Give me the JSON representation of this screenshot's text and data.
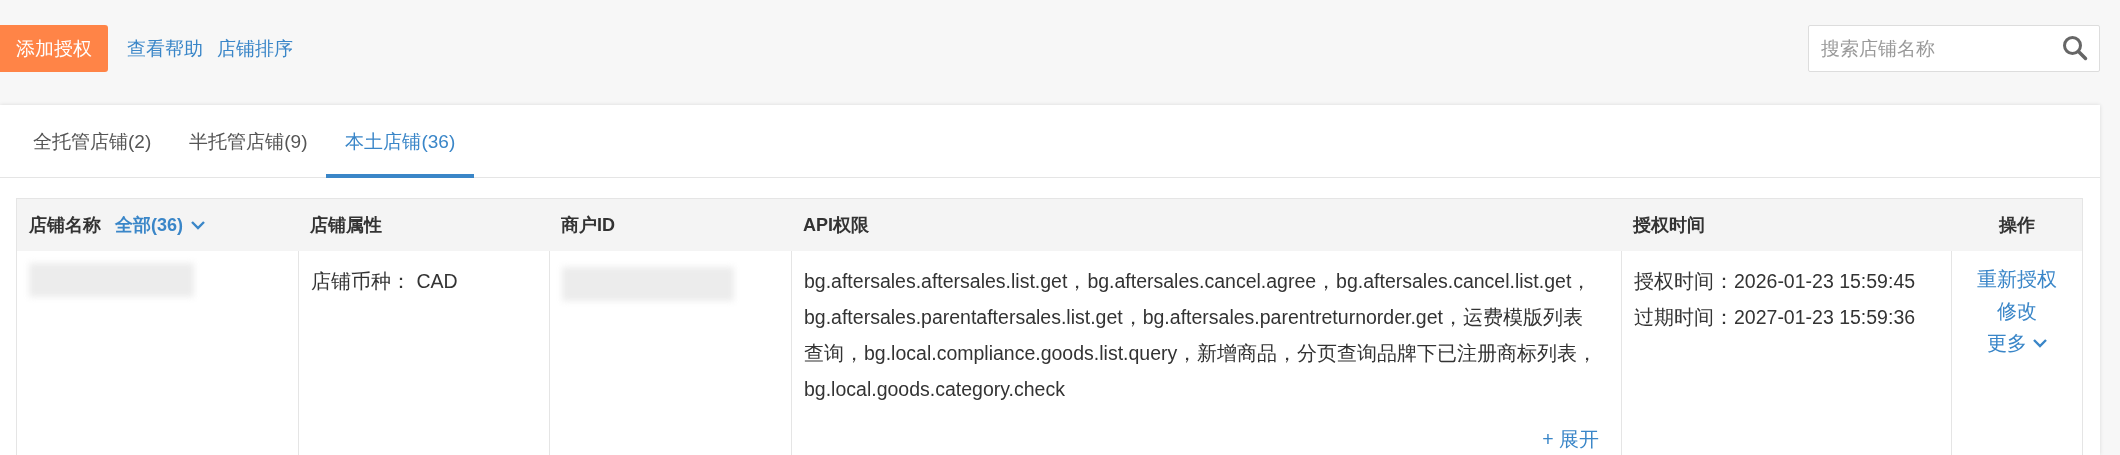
{
  "toolbar": {
    "add_button": "添加授权",
    "links": [
      "查看帮助",
      "店铺排序"
    ],
    "search": {
      "placeholder": "搜索店铺名称"
    }
  },
  "tabs": [
    {
      "label": "全托管店铺(2)",
      "selected": false
    },
    {
      "label": "半托管店铺(9)",
      "selected": false
    },
    {
      "label": "本土店铺(36)",
      "selected": true
    }
  ],
  "table": {
    "columns": [
      {
        "label": "店铺名称",
        "filter": "全部(36)"
      },
      {
        "label": "店铺属性"
      },
      {
        "label": "商户ID"
      },
      {
        "label": "API权限"
      },
      {
        "label": "授权时间"
      },
      {
        "label": "操作"
      }
    ],
    "rows": [
      {
        "attribute": "店铺币种： CAD",
        "api": "bg.aftersales.aftersales.list.get，bg.aftersales.cancel.agree，bg.aftersales.cancel.list.get，bg.aftersales.parentaftersales.list.get，bg.aftersales.parentreturnorder.get，运费模版列表查询，bg.local.compliance.goods.list.query，新增商品，分页查询品牌下已注册商标列表，bg.local.goods.category.check",
        "expand": "+ 展开",
        "times": [
          "授权时间：2026-01-23 15:59:45",
          "过期时间：2027-01-23 15:59:36"
        ],
        "actions": [
          "重新授权",
          "修改",
          "更多"
        ]
      }
    ]
  }
}
